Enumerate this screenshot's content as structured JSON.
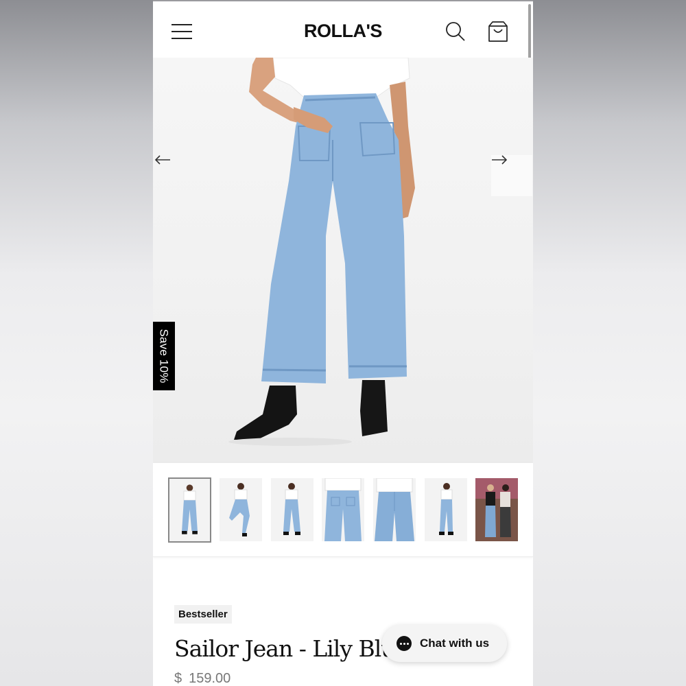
{
  "header": {
    "logo": "ROLLA'S",
    "icons": [
      "menu-icon",
      "search-icon",
      "cart-icon"
    ]
  },
  "hero": {
    "prev_icon": "arrow-left-icon",
    "next_icon": "arrow-right-icon",
    "promo_tab": "Save 10%"
  },
  "thumbnails": {
    "count": 7,
    "selected_index": 0
  },
  "product": {
    "badge": "Bestseller",
    "title": "Sailor Jean - Lily Blue",
    "currency": "$",
    "price": "159.00"
  },
  "chat": {
    "label": "Chat with us",
    "icon": "chat-bubble-icon"
  },
  "colors": {
    "denim": "#8fb5dc",
    "accent": "#000000",
    "price_text": "#777777"
  }
}
